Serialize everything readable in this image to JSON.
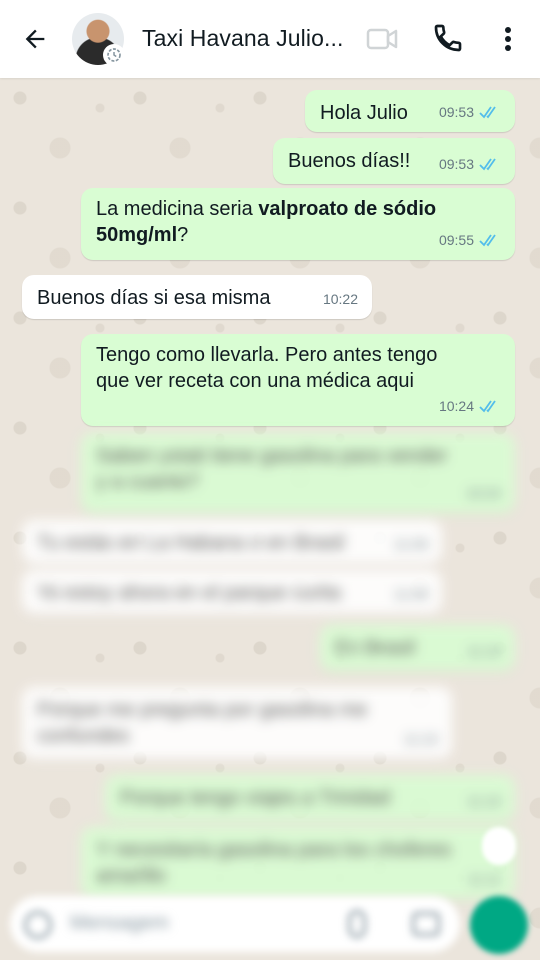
{
  "header": {
    "contact_name": "Taxi Havana Julio...",
    "icons": {
      "back": "arrow-left-icon",
      "video": "video-camera-icon",
      "call": "phone-icon",
      "menu": "more-vertical-icon"
    }
  },
  "colors": {
    "outgoing_bubble": "#d9fdd3",
    "incoming_bubble": "#ffffff",
    "read_ticks": "#53bdeb",
    "accent": "#00a884"
  },
  "messages": [
    {
      "direction": "out",
      "text": "Hola Julio",
      "time": "09:53",
      "status": "read"
    },
    {
      "direction": "out",
      "text": "Buenos días!!",
      "time": "09:53",
      "status": "read"
    },
    {
      "direction": "out",
      "text_prefix": "La medicina seria ",
      "text_bold": "valproato de sódio",
      "text_line2_bold": "50mg/ml",
      "text_line2_suffix": "?",
      "time": "09:55",
      "status": "read"
    },
    {
      "direction": "in",
      "text": "Buenos días si esa misma",
      "time": "10:22"
    },
    {
      "direction": "out",
      "text_line1": "Tengo como llevarla. Pero antes tengo",
      "text_line2": "que ver receta con una médica aqui",
      "time": "10:24",
      "status": "read"
    }
  ],
  "blurred_messages": [
    {
      "direction": "out",
      "text_line1": "Saben ystati tiene gasolina para vender",
      "text_line2": "y a cuanto?",
      "time": "10:24"
    },
    {
      "direction": "in",
      "text": "Tu estás en La Habana o en Brasil",
      "time": "11:09"
    },
    {
      "direction": "in",
      "text": "Yo estoy ahora en el parque curita",
      "time": "11:09"
    },
    {
      "direction": "out",
      "text": "En Brasil",
      "time": "11:10"
    },
    {
      "direction": "in",
      "text_line1": "Porque me pregunta por gasolina me",
      "text_line2": "confundes",
      "time": "11:10"
    },
    {
      "direction": "out",
      "text": "Porque tengo viajes a Trinidad",
      "time": "11:10"
    },
    {
      "direction": "out",
      "text_line1": "Y necesitaría gasolina para los choferes",
      "text_line2": "amarillo",
      "time": "11:11"
    }
  ],
  "composer": {
    "placeholder": "Mensagem",
    "icons": {
      "emoji": "emoji-icon",
      "attach": "paperclip-icon",
      "camera": "camera-icon",
      "send": "mic-icon"
    }
  }
}
